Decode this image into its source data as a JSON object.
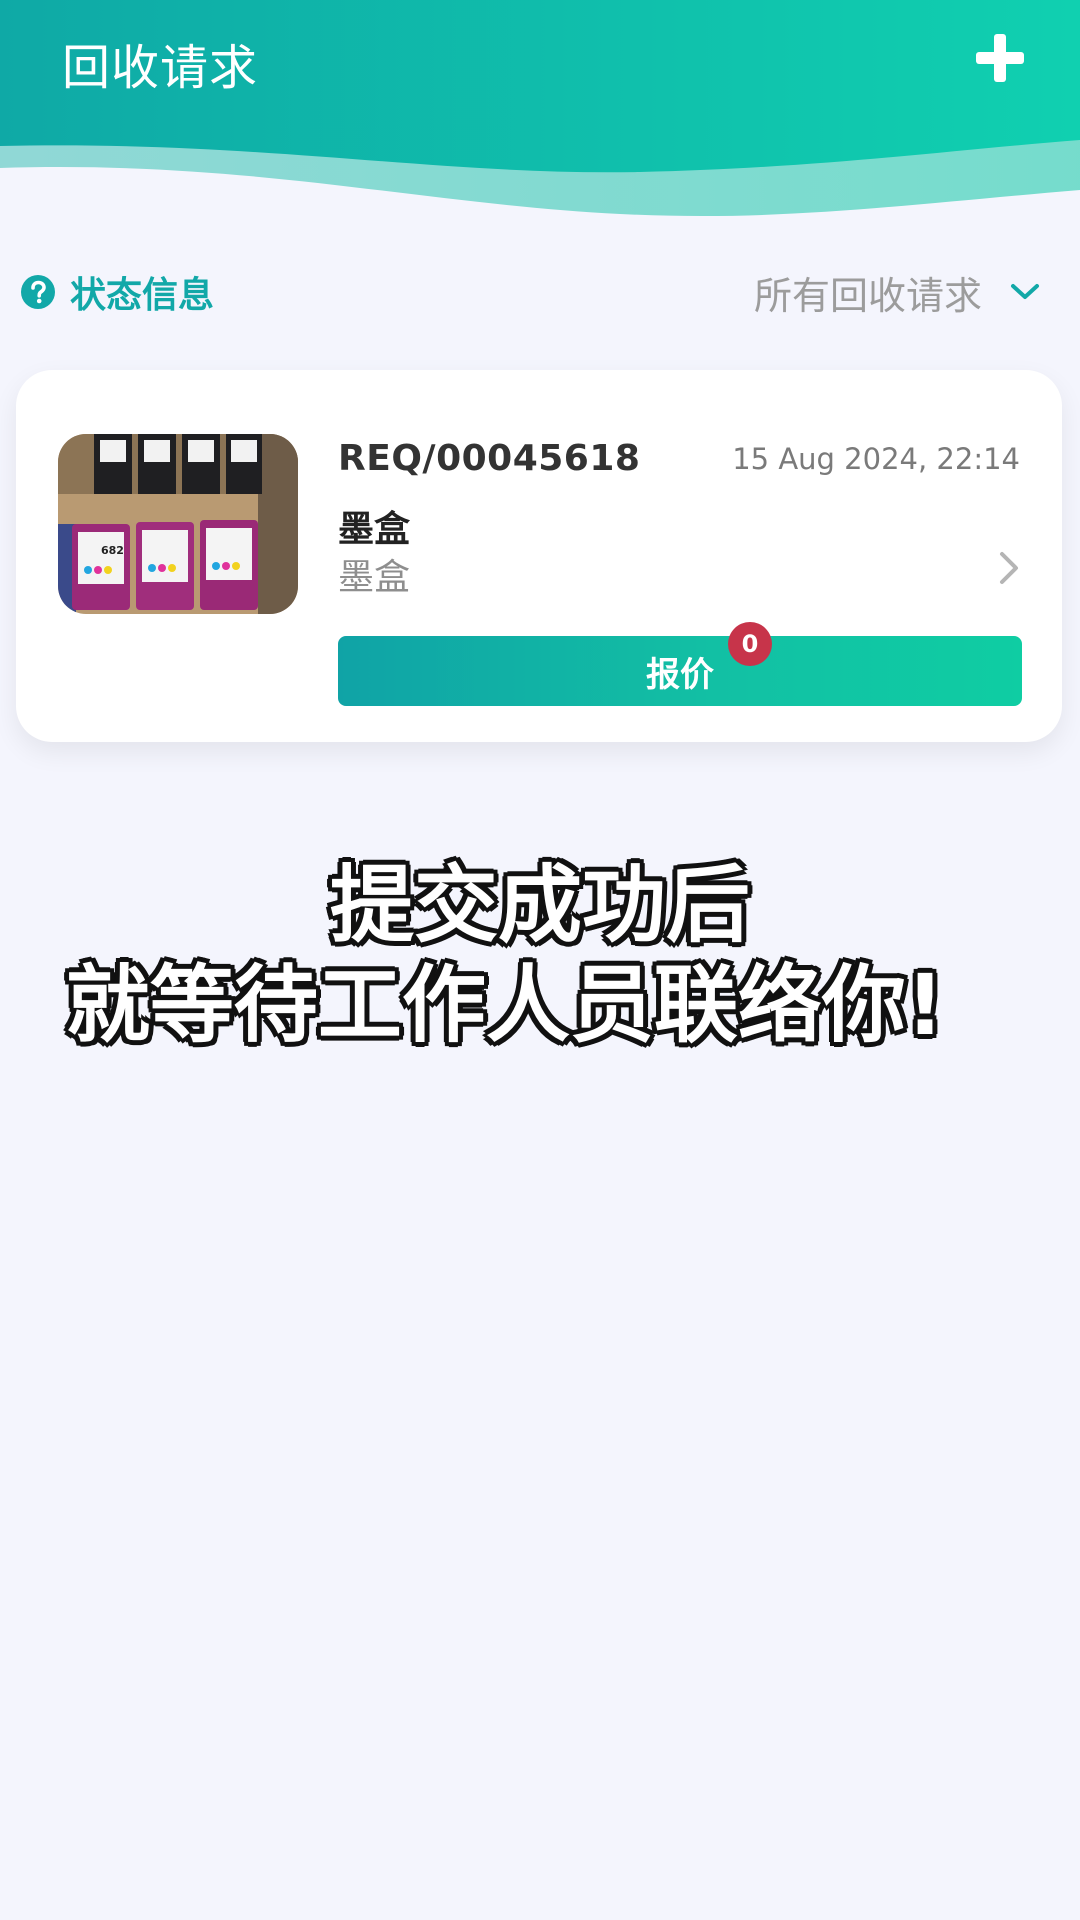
{
  "header": {
    "title": "回收请求",
    "add_icon": "plus-icon",
    "gradient_start": "#0fa9a6",
    "gradient_end": "#10d0b0"
  },
  "filter_bar": {
    "status_info_label": "状态信息",
    "status_info_icon": "question-circle-icon",
    "filter_label": "所有回收请求",
    "filter_icon": "chevron-down-icon",
    "accent_color": "#12a8a8"
  },
  "request_card": {
    "request_id": "REQ/00045618",
    "date": "15 Aug 2024, 22:14",
    "item_title": "墨盒",
    "item_subtitle": "墨盒",
    "thumbnail": "ink-cartridges-photo",
    "thumbnail_text": "682",
    "quote_button_label": "报价",
    "quote_badge_count": "0",
    "badge_color": "#c7344a"
  },
  "caption": {
    "line1": "提交成功后",
    "line2": "就等待工作人员联络你!"
  }
}
